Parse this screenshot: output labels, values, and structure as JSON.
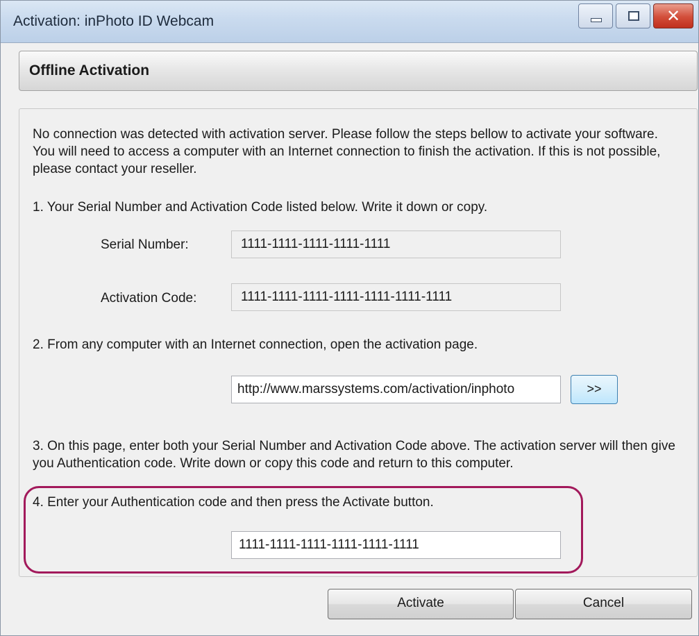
{
  "window": {
    "title": "Activation: inPhoto ID Webcam",
    "controls": {
      "minimize_icon": "minimize-icon",
      "maximize_icon": "maximize-icon",
      "close_icon": "close-icon",
      "close_glyph": "✕"
    }
  },
  "header": {
    "title": "Offline Activation"
  },
  "intro": "No connection was detected with activation server. Please follow the steps bellow to activate your software. You will need to access a computer with an Internet connection to finish the activation. If this is not possible, please contact your reseller.",
  "step1": {
    "text": "1. Your Serial Number and Activation Code listed below. Write it down or copy.",
    "serial_label": "Serial Number:",
    "serial_value": "1111-1111-1111-1111-1111",
    "activation_label": "Activation Code:",
    "activation_value": "1111-1111-1111-1111-1111-1111-1111"
  },
  "step2": {
    "text": "2. From any computer with an Internet connection, open the activation page.",
    "url": "http://www.marssystems.com/activation/inphoto",
    "open_button_label": ">>"
  },
  "step3": {
    "text": "3. On this page, enter both your Serial Number and Activation Code above. The activation server will then give you Authentication code. Write down or copy this code and return to this computer."
  },
  "step4": {
    "text": "4. Enter your Authentication code and then press the Activate button.",
    "auth_value": "1111-1111-1111-1111-1111-1111"
  },
  "buttons": {
    "activate": "Activate",
    "cancel": "Cancel"
  },
  "colors": {
    "highlight": "#a2195b",
    "titlebar": "#c9daee",
    "close_button": "#d24d39"
  }
}
